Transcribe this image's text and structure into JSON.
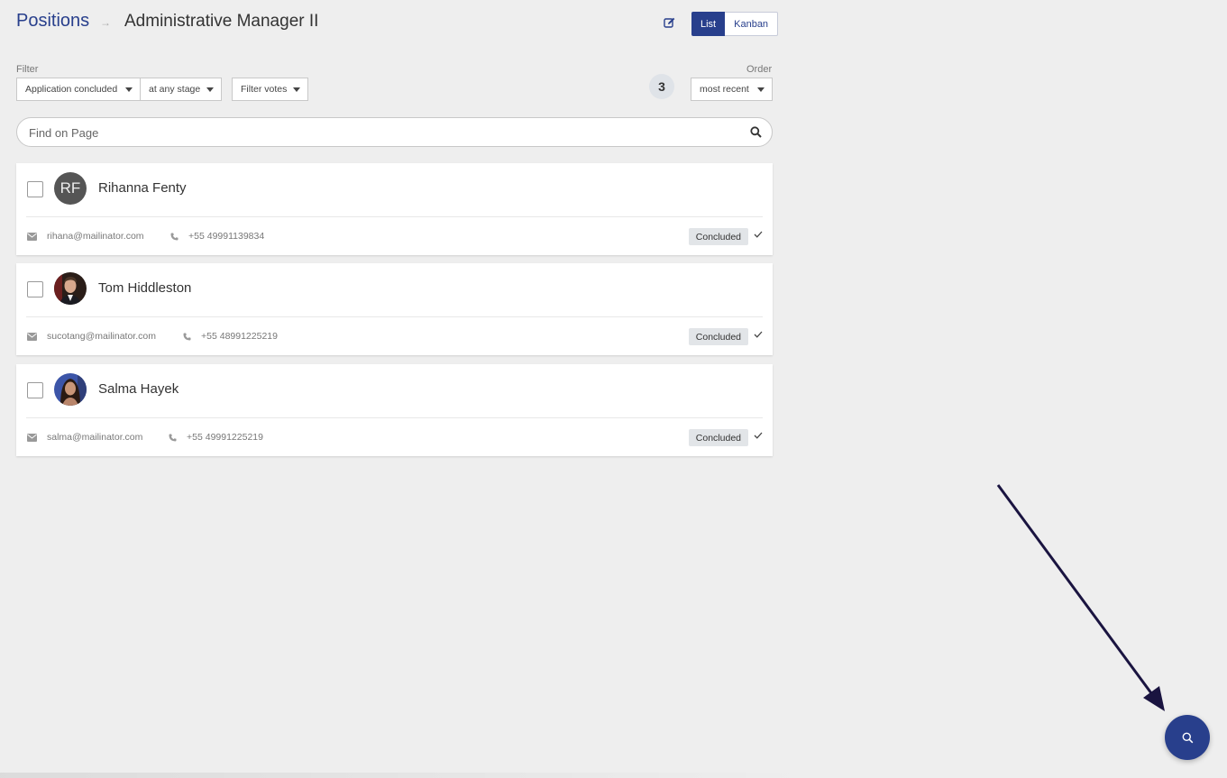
{
  "header": {
    "breadcrumb_root": "Positions",
    "breadcrumb_sep": "→",
    "title": "Administrative Manager II",
    "view_list": "List",
    "view_kanban": "Kanban"
  },
  "filter": {
    "label": "Filter",
    "application_status": "Application concluded",
    "stage": "at any stage",
    "votes": "Filter votes",
    "count": "3",
    "order_label": "Order",
    "order": "most recent"
  },
  "search": {
    "placeholder": "Find on Page"
  },
  "candidates": [
    {
      "name": "Rihanna Fenty",
      "initials": "RF",
      "email": "rihana@mailinator.com",
      "phone": "+55 49991139834",
      "status": "Concluded"
    },
    {
      "name": "Tom Hiddleston",
      "email": "sucotang@mailinator.com",
      "phone": "+55 48991225219",
      "status": "Concluded"
    },
    {
      "name": "Salma Hayek",
      "email": "salma@mailinator.com",
      "phone": "+55 49991225219",
      "status": "Concluded"
    }
  ],
  "colors": {
    "primary": "#283f8c",
    "background": "#eeeeee",
    "annotation_arrow": "#1a1440"
  }
}
